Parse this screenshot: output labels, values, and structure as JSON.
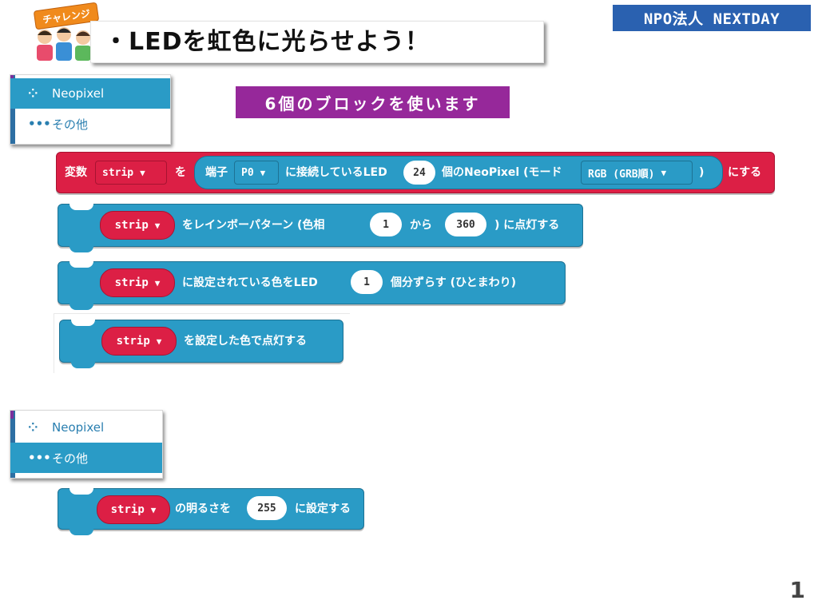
{
  "header": {
    "challenge_badge": "チャレンジ",
    "title": "・LEDを虹色に光らせよう！",
    "org": "NPO法人 NEXTDAY",
    "blocks_note": "6個のブロックを使います"
  },
  "panel1": {
    "items": [
      {
        "label": "Neopixel",
        "icon": "neopixel-icon",
        "selected": true
      },
      {
        "label": "その他",
        "icon": "more-dots-icon",
        "selected": false
      }
    ]
  },
  "panel2": {
    "items": [
      {
        "label": "Neopixel",
        "icon": "neopixel-icon",
        "selected": false
      },
      {
        "label": "その他",
        "icon": "more-dots-icon",
        "selected": true
      }
    ]
  },
  "block_set_var": {
    "prefix": "変数",
    "var": "strip",
    "wo": "を",
    "pin_label": "端子",
    "pin": "P0",
    "connected": "に接続しているLED",
    "count": "24",
    "neopixel_mode": "個のNeoPixel (モード",
    "mode": "RGB (GRB順)",
    "close": ")",
    "suffix": "にする"
  },
  "block_rainbow": {
    "var": "strip",
    "pre": "をレインボーパターン (色相",
    "from": "1",
    "kara": "から",
    "to": "360",
    "post": ") に点灯する"
  },
  "block_rotate": {
    "var": "strip",
    "pre": "に設定されている色をLED",
    "offset": "1",
    "post": "個分ずらす (ひとまわり)"
  },
  "block_show": {
    "var": "strip",
    "text": "を設定した色で点灯する"
  },
  "block_brightness": {
    "var": "strip",
    "pre": "の明るさを",
    "value": "255",
    "post": "に設定する"
  },
  "page_number": "1",
  "colors": {
    "red": "#dc1f45",
    "blue": "#2a9bc6",
    "purple": "#96289a",
    "npo": "#2a61b0"
  }
}
